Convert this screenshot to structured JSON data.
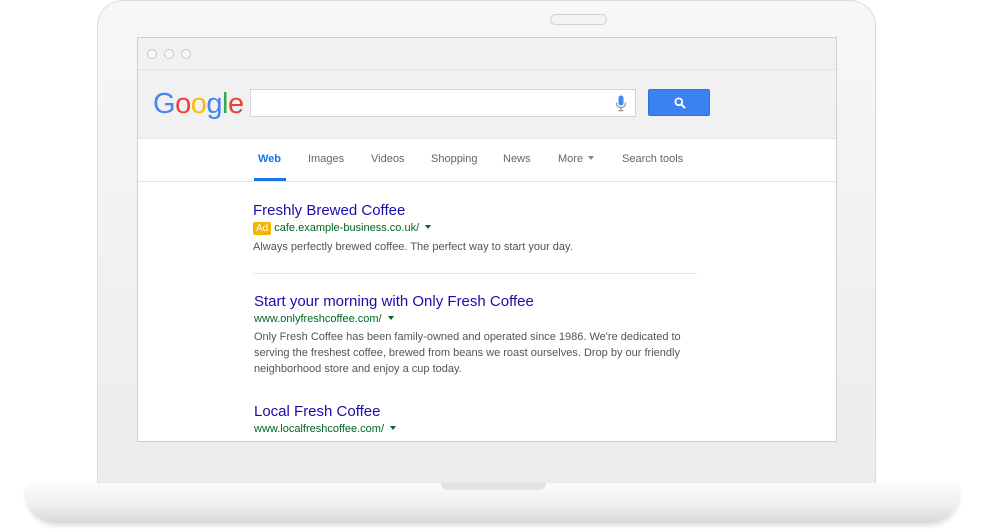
{
  "logo": {
    "letters": [
      "G",
      "o",
      "o",
      "g",
      "l",
      "e"
    ],
    "colors": [
      "#4285f4",
      "#ea4335",
      "#fbbc05",
      "#4285f4",
      "#34a853",
      "#ea4335"
    ]
  },
  "search": {
    "value": "",
    "placeholder": ""
  },
  "tabs": [
    {
      "label": "Web",
      "active": true
    },
    {
      "label": "Images"
    },
    {
      "label": "Videos"
    },
    {
      "label": "Shopping"
    },
    {
      "label": "News"
    },
    {
      "label": "More"
    },
    {
      "label": "Search tools"
    }
  ],
  "results": [
    {
      "title": "Freshly Brewed Coffee",
      "ad_label": "Ad",
      "url": "cafe.example-business.co.uk/",
      "snippet": "Always perfectly brewed coffee. The perfect way to start your day."
    },
    {
      "title": "Start your morning with Only Fresh Coffee",
      "url": "www.onlyfreshcoffee.com/",
      "snippet_lines": [
        "Only Fresh Coffee has been family-owned and operated since 1986. We're dedicated to",
        "serving the freshest coffee, brewed from beans we roast ourselves. Drop by our friendly",
        "neighborhood store and enjoy a cup today."
      ]
    },
    {
      "title": "Local Fresh Coffee",
      "url": "www.localfreshcoffee.com/"
    }
  ],
  "colors": {
    "link": "#1a0dab",
    "url": "#006621",
    "accent": "#1a73e8",
    "ad_badge": "#f5b400",
    "search_button": "#3b82f0"
  },
  "icons": {
    "mic": "microphone-icon",
    "search": "magnifier-icon",
    "more_caret": "caret-down-icon",
    "url_caret": "caret-down-icon"
  }
}
